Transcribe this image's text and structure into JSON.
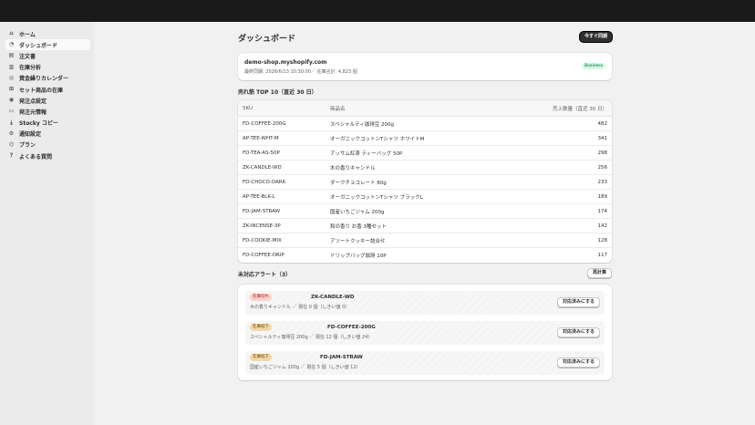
{
  "sidebar": {
    "items": [
      {
        "label": "ホーム",
        "icon": "home-icon",
        "glyph": "⌂",
        "name": "sidebar-item-home"
      },
      {
        "label": "ダッシュボード",
        "icon": "dashboard-icon",
        "glyph": "◔",
        "name": "sidebar-item-dashboard",
        "active": true
      },
      {
        "label": "注文書",
        "icon": "document-icon",
        "glyph": "▤",
        "name": "sidebar-item-purchase-orders"
      },
      {
        "label": "在庫分析",
        "icon": "bar-chart-icon",
        "glyph": "▥",
        "name": "sidebar-item-inventory-analysis"
      },
      {
        "label": "資金繰りカレンダー",
        "icon": "money-icon",
        "glyph": "◎",
        "name": "sidebar-item-cashflow-calendar"
      },
      {
        "label": "セット商品の在庫",
        "icon": "bundle-icon",
        "glyph": "⊞",
        "name": "sidebar-item-bundle-inventory"
      },
      {
        "label": "発注点設定",
        "icon": "reorder-point-icon",
        "glyph": "◉",
        "name": "sidebar-item-reorder-settings"
      },
      {
        "label": "発注元情報",
        "icon": "supplier-icon",
        "glyph": "▭",
        "name": "sidebar-item-suppliers"
      },
      {
        "label": "Stocky コピー",
        "icon": "import-icon",
        "glyph": "⤓",
        "name": "sidebar-item-stocky-copy"
      },
      {
        "label": "通知設定",
        "icon": "gear-icon",
        "glyph": "⚙",
        "name": "sidebar-item-notification-settings"
      },
      {
        "label": "プラン",
        "icon": "plan-icon",
        "glyph": "⌬",
        "name": "sidebar-item-plan"
      },
      {
        "label": "よくある質問",
        "icon": "question-icon",
        "glyph": "?",
        "name": "sidebar-item-faq"
      }
    ]
  },
  "header": {
    "title": "ダッシュボード",
    "sync_label": "今すぐ同期"
  },
  "shop": {
    "domain": "demo-shop.myshopify.com",
    "meta": "最終同期: 2026/6/13 10:30:00／ 在庫合計: 4,823 個",
    "plan": "Business"
  },
  "top_sellers": {
    "title": "売れ筋 TOP 10（直近 30 日）",
    "columns": {
      "sku": "SKU",
      "name": "商品名",
      "qty": "売上数量（直近 30 日）"
    },
    "rows": [
      {
        "sku": "FD-COFFEE-200G",
        "name": "スペシャルティ珈琲豆 200g",
        "qty": "482"
      },
      {
        "sku": "AP-TEE-WHT-M",
        "name": "オーガニックコットンTシャツ ホワイトM",
        "qty": "341"
      },
      {
        "sku": "FD-TEA-AS-50P",
        "name": "アッサム紅茶 ティーバッグ 50P",
        "qty": "298"
      },
      {
        "sku": "ZK-CANDLE-WD",
        "name": "木の香りキャンドル",
        "qty": "256"
      },
      {
        "sku": "FD-CHOCO-DARK",
        "name": "ダークチョコレート 80g",
        "qty": "233"
      },
      {
        "sku": "AP-TEE-BLK-L",
        "name": "オーガニックコットンTシャツ ブラックL",
        "qty": "189"
      },
      {
        "sku": "FD-JAM-STRAW",
        "name": "国産いちごジャム 200g",
        "qty": "174"
      },
      {
        "sku": "ZK-INCENSE-3P",
        "name": "和の香り お香 3種セット",
        "qty": "142"
      },
      {
        "sku": "FD-COOKIE-MIX",
        "name": "アソートクッキー詰合せ",
        "qty": "128"
      },
      {
        "sku": "FD-COFFEE-DRIP",
        "name": "ドリップバッグ珈琲 10P",
        "qty": "117"
      }
    ]
  },
  "alerts": {
    "title": "未対応アラート（3）",
    "recalc_label": "再計算",
    "items": [
      {
        "badge": "在庫切れ",
        "severity": "critical",
        "sku": "ZK-CANDLE-WD",
        "detail": "木の香りキャンドル ／ 現在 0 個（しきい値 0）",
        "action": "対応済みにする"
      },
      {
        "badge": "在庫低下",
        "severity": "warning",
        "sku": "FD-COFFEE-200G",
        "detail": "スペシャルティ珈琲豆 200g ／ 現在 12 個（しきい値 24）",
        "action": "対応済みにする"
      },
      {
        "badge": "在庫低下",
        "severity": "warning",
        "sku": "FD-JAM-STRAW",
        "detail": "国産いちごジャム 200g ／ 現在 5 個（しきい値 12）",
        "action": "対応済みにする"
      }
    ]
  },
  "colors": {
    "topbar": "#1a1a1a",
    "sidebar": "#ebebeb",
    "background": "#f1f1f1",
    "badge_success": "#cdfee1",
    "badge_warning": "#f5d8a8",
    "badge_critical": "#fed1c9"
  }
}
